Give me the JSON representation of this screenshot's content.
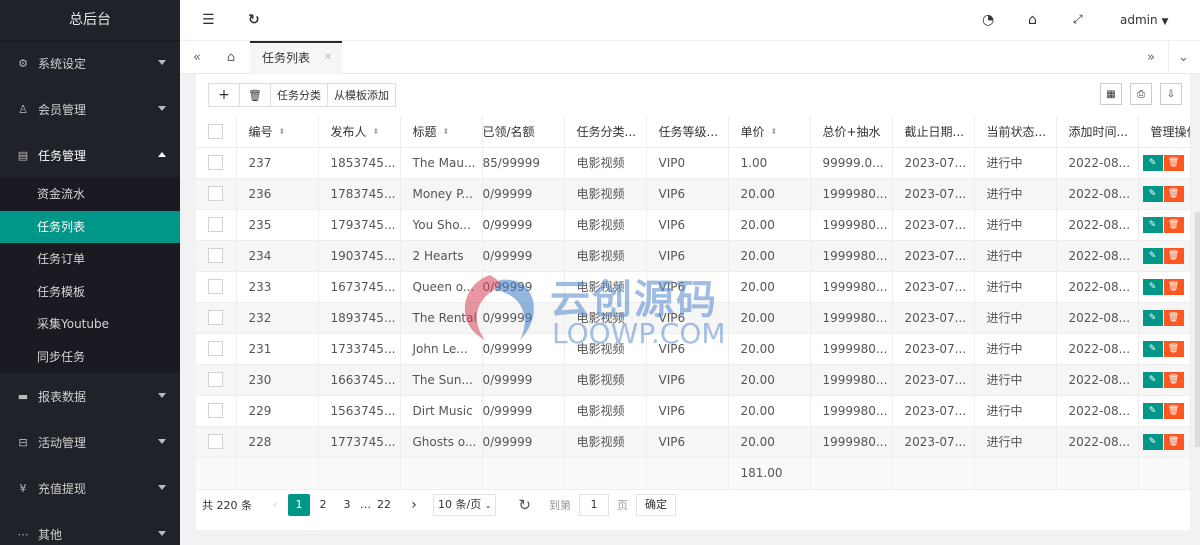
{
  "app": {
    "title": "总后台"
  },
  "sidebar": {
    "groups": [
      {
        "label": "系统设定",
        "icon": "gear-icon"
      },
      {
        "label": "会员管理",
        "icon": "user-icon"
      },
      {
        "label": "任务管理",
        "icon": "document-icon",
        "expanded": true,
        "items": [
          {
            "label": "资金流水"
          },
          {
            "label": "任务列表",
            "active": true
          },
          {
            "label": "任务订单"
          },
          {
            "label": "任务模板"
          },
          {
            "label": "采集Youtube"
          },
          {
            "label": "同步任务"
          }
        ]
      },
      {
        "label": "报表数据",
        "icon": "chart-icon"
      },
      {
        "label": "活动管理",
        "icon": "car-icon"
      },
      {
        "label": "充值提现",
        "icon": "money-icon"
      },
      {
        "label": "其他",
        "icon": "more-icon"
      }
    ]
  },
  "header": {
    "user": "admin"
  },
  "tabs": {
    "active": "任务列表"
  },
  "toolbar": {
    "add": "+",
    "delete": "🗑",
    "category": "任务分类",
    "from_template": "从模板添加"
  },
  "table": {
    "columns": [
      "编号",
      "发布人",
      "标题",
      "已领/名额",
      "任务分类...",
      "任务等级...",
      "单价",
      "总价+抽水",
      "截止日期...",
      "当前状态...",
      "添加时间...",
      "管理操作"
    ],
    "rows": [
      [
        "237",
        "1853745...",
        "The Mau...",
        "85/99999",
        "电影视频",
        "VIP0",
        "1.00",
        "99999.0...",
        "2023-07...",
        "进行中",
        "2022-08..."
      ],
      [
        "236",
        "1783745...",
        "Money P...",
        "0/99999",
        "电影视频",
        "VIP6",
        "20.00",
        "1999980...",
        "2023-07...",
        "进行中",
        "2022-08..."
      ],
      [
        "235",
        "1793745...",
        "You Sho...",
        "0/99999",
        "电影视频",
        "VIP6",
        "20.00",
        "1999980...",
        "2023-07...",
        "进行中",
        "2022-08..."
      ],
      [
        "234",
        "1903745...",
        "2 Hearts",
        "0/99999",
        "电影视频",
        "VIP6",
        "20.00",
        "1999980...",
        "2023-07...",
        "进行中",
        "2022-08..."
      ],
      [
        "233",
        "1673745...",
        "Queen o...",
        "0/99999",
        "电影视频",
        "VIP6",
        "20.00",
        "1999980...",
        "2023-07...",
        "进行中",
        "2022-08..."
      ],
      [
        "232",
        "1893745...",
        "The Rental",
        "0/99999",
        "电影视频",
        "VIP6",
        "20.00",
        "1999980...",
        "2023-07...",
        "进行中",
        "2022-08..."
      ],
      [
        "231",
        "1733745...",
        "John Le...",
        "0/99999",
        "电影视频",
        "VIP6",
        "20.00",
        "1999980...",
        "2023-07...",
        "进行中",
        "2022-08..."
      ],
      [
        "230",
        "1663745...",
        "The Sun...",
        "0/99999",
        "电影视频",
        "VIP6",
        "20.00",
        "1999980...",
        "2023-07...",
        "进行中",
        "2022-08..."
      ],
      [
        "229",
        "1563745...",
        "Dirt Music",
        "0/99999",
        "电影视频",
        "VIP6",
        "20.00",
        "1999980...",
        "2023-07...",
        "进行中",
        "2022-08..."
      ],
      [
        "228",
        "1773745...",
        "Ghosts o...",
        "0/99999",
        "电影视频",
        "VIP6",
        "20.00",
        "1999980...",
        "2023-07...",
        "进行中",
        "2022-08..."
      ]
    ],
    "total_price": "181.00"
  },
  "pager": {
    "total": "共 220 条",
    "pages": [
      "1",
      "2",
      "3",
      "…",
      "22"
    ],
    "page_size": "10 条/页",
    "goto": "到第",
    "goto_value": "1",
    "page_unit": "页",
    "confirm": "确定"
  },
  "watermark": {
    "line1": "云创源码",
    "line2": "LOOWP.COM"
  }
}
